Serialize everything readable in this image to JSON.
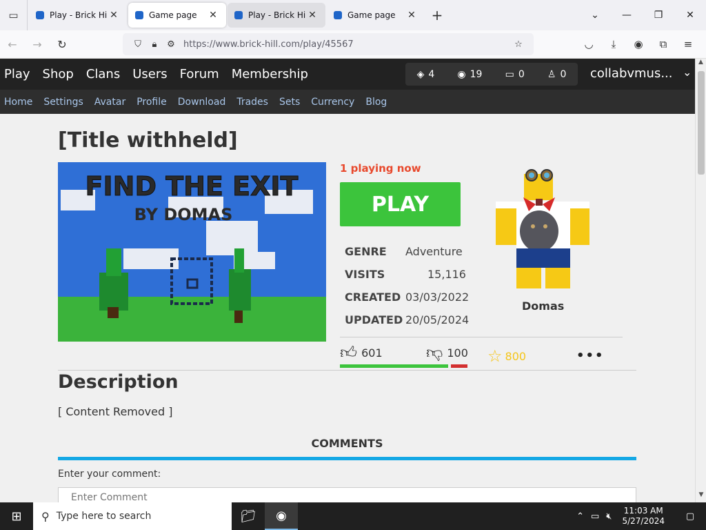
{
  "browser": {
    "tabs": [
      {
        "title": "Play - Brick Hill",
        "close": "✕",
        "state": "normal"
      },
      {
        "title": "Game page",
        "close": "✕",
        "state": "active"
      },
      {
        "title": "Play - Brick Hill",
        "close": "✕",
        "state": "hover"
      },
      {
        "title": "Game page",
        "close": "✕",
        "state": "normal"
      }
    ],
    "new_tab": "+",
    "url": "https://www.brick-hill.com/play/45567"
  },
  "site": {
    "menu": [
      "Play",
      "Shop",
      "Clans",
      "Users",
      "Forum",
      "Membership"
    ],
    "stats": [
      {
        "icon": "bits-icon",
        "value": "4"
      },
      {
        "icon": "bucks-icon",
        "value": "19"
      },
      {
        "icon": "messages-icon",
        "value": "0"
      },
      {
        "icon": "friends-icon",
        "value": "0"
      }
    ],
    "username": "collabvmus...",
    "submenu": [
      "Home",
      "Settings",
      "Avatar",
      "Profile",
      "Download",
      "Trades",
      "Sets",
      "Currency",
      "Blog"
    ]
  },
  "game": {
    "title": "[Title withheld]",
    "thumbnail_title": "FIND THE EXIT",
    "thumbnail_subtitle": "BY DOMAS",
    "playing": "1 playing now",
    "play_label": "PLAY",
    "info": [
      {
        "key": "GENRE",
        "value": "Adventure"
      },
      {
        "key": "VISITS",
        "value": "15,116"
      },
      {
        "key": "CREATED",
        "value": "03/03/2022"
      },
      {
        "key": "UPDATED",
        "value": "20/05/2024"
      }
    ],
    "creator": "Domas",
    "upvotes": "601",
    "downvotes": "100",
    "favorites": "800",
    "more": "•••"
  },
  "description": {
    "heading": "Description",
    "text": "[ Content Removed ]"
  },
  "comments": {
    "heading": "COMMENTS",
    "label": "Enter your comment:",
    "placeholder": "Enter Comment"
  },
  "taskbar": {
    "search_placeholder": "Type here to search",
    "time": "11:03 AM",
    "date": "5/27/2024"
  },
  "colors": {
    "play_green": "#3cc43c",
    "playing_red": "#e8492d",
    "link_blue": "#a9c6ea",
    "comments_blue": "#14a8e5",
    "favorite_gold": "#f5c518"
  }
}
